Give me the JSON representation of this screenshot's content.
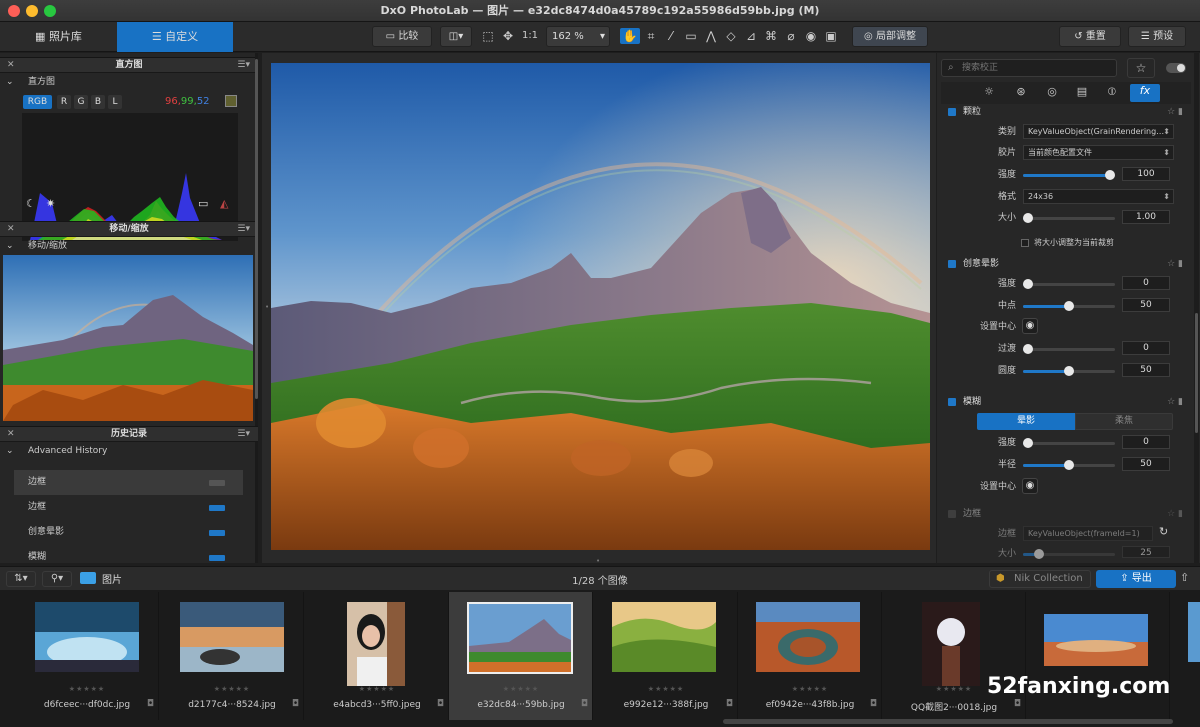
{
  "window": {
    "title": "DxO PhotoLab — 图片 — e32dc8474d0a45789c192a55986d59bb.jpg (M)"
  },
  "toolbar": {
    "tab_library": "照片库",
    "tab_customize": "自定义",
    "compare": "比较",
    "zoom_fit": "1:1",
    "zoom_level": "162 %",
    "local_adjust": "局部调整",
    "reset": "重置",
    "preset": "预设"
  },
  "left": {
    "histogram": {
      "title": "直方图",
      "sub": "直方图",
      "channels": [
        "RGB",
        "R",
        "G",
        "B",
        "L"
      ],
      "r": "96,",
      "g": "99,",
      "b": "52"
    },
    "move": {
      "title": "移动/缩放",
      "sub": "移动/缩放"
    },
    "history": {
      "title": "历史记录",
      "sub": "Advanced History",
      "items": [
        "边框",
        "边框",
        "创意晕影",
        "模糊"
      ]
    }
  },
  "right": {
    "search_placeholder": "搜索校正",
    "grain": {
      "name": "颗粒",
      "type_label": "类别",
      "type_value": "KeyValueObject(GrainRendering…",
      "film_label": "胶片",
      "film_value": "当前颜色配置文件",
      "strength_label": "强度",
      "strength_value": "100",
      "strength": 1.0,
      "format_label": "格式",
      "format_value": "24x36",
      "size_label": "大小",
      "size_value": "1.00",
      "size": 0.0,
      "fit_label": "将大小调整为当前裁剪"
    },
    "vignette": {
      "name": "创意晕影",
      "strength_label": "强度",
      "strength_value": "0",
      "strength": 0.0,
      "mid_label": "中点",
      "mid_value": "50",
      "mid": 0.5,
      "center_label": "设置中心",
      "trans_label": "过渡",
      "trans_value": "0",
      "trans": 0.0,
      "round_label": "圆度",
      "round_value": "50",
      "round": 0.5
    },
    "blur": {
      "name": "模糊",
      "mode_a": "晕影",
      "mode_b": "柔焦",
      "strength_label": "强度",
      "strength_value": "0",
      "strength": 0.0,
      "radius_label": "半径",
      "radius_value": "50",
      "radius": 0.5,
      "center_label": "设置中心"
    },
    "frame": {
      "name": "边框",
      "frame_label": "边框",
      "frame_value": "KeyValueObject(frameId=1)",
      "size_label": "大小",
      "size_value": "25",
      "size": 0.13
    }
  },
  "filmstrip": {
    "folder": "图片",
    "count": "1/28 个图像",
    "nik": "Nik Collection",
    "export": "导出",
    "items": [
      {
        "name": "d6fceec···df0dc.jpg"
      },
      {
        "name": "d2177c4···8524.jpg"
      },
      {
        "name": "e4abcd3···5ff0.jpeg"
      },
      {
        "name": "e32dc84···59bb.jpg"
      },
      {
        "name": "e992e12···388f.jpg"
      },
      {
        "name": "ef0942e···43f8b.jpg"
      },
      {
        "name": "QQ截图2···0018.jpg"
      },
      {
        "name": ""
      }
    ]
  },
  "watermark": "52fanxing.com"
}
